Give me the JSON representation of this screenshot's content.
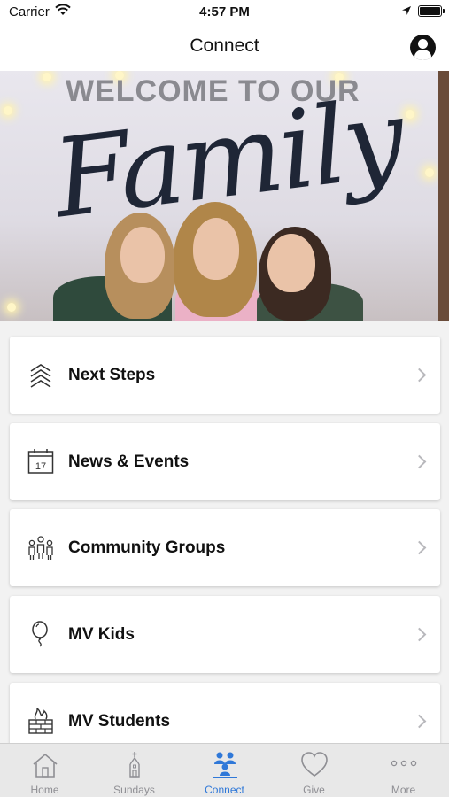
{
  "status_bar": {
    "carrier": "Carrier",
    "time": "4:57 PM"
  },
  "nav": {
    "title": "Connect"
  },
  "hero": {
    "welcome_text": "WELCOME TO OUR",
    "family_text": "Family"
  },
  "menu": [
    {
      "label": "Next Steps",
      "icon": "chevrons-up-icon"
    },
    {
      "label": "News & Events",
      "icon": "calendar-icon",
      "icon_text": "17"
    },
    {
      "label": "Community Groups",
      "icon": "people-group-icon"
    },
    {
      "label": "MV Kids",
      "icon": "balloon-icon"
    },
    {
      "label": "MV Students",
      "icon": "campfire-icon"
    }
  ],
  "tabs": [
    {
      "label": "Home",
      "icon": "home-icon",
      "active": false
    },
    {
      "label": "Sundays",
      "icon": "church-icon",
      "active": false
    },
    {
      "label": "Connect",
      "icon": "connect-icon",
      "active": true
    },
    {
      "label": "Give",
      "icon": "heart-icon",
      "active": false
    },
    {
      "label": "More",
      "icon": "more-icon",
      "active": false
    }
  ],
  "colors": {
    "accent": "#2f78d8",
    "inactive_tab": "#8e8e93",
    "chevron": "#b8b8bc"
  }
}
